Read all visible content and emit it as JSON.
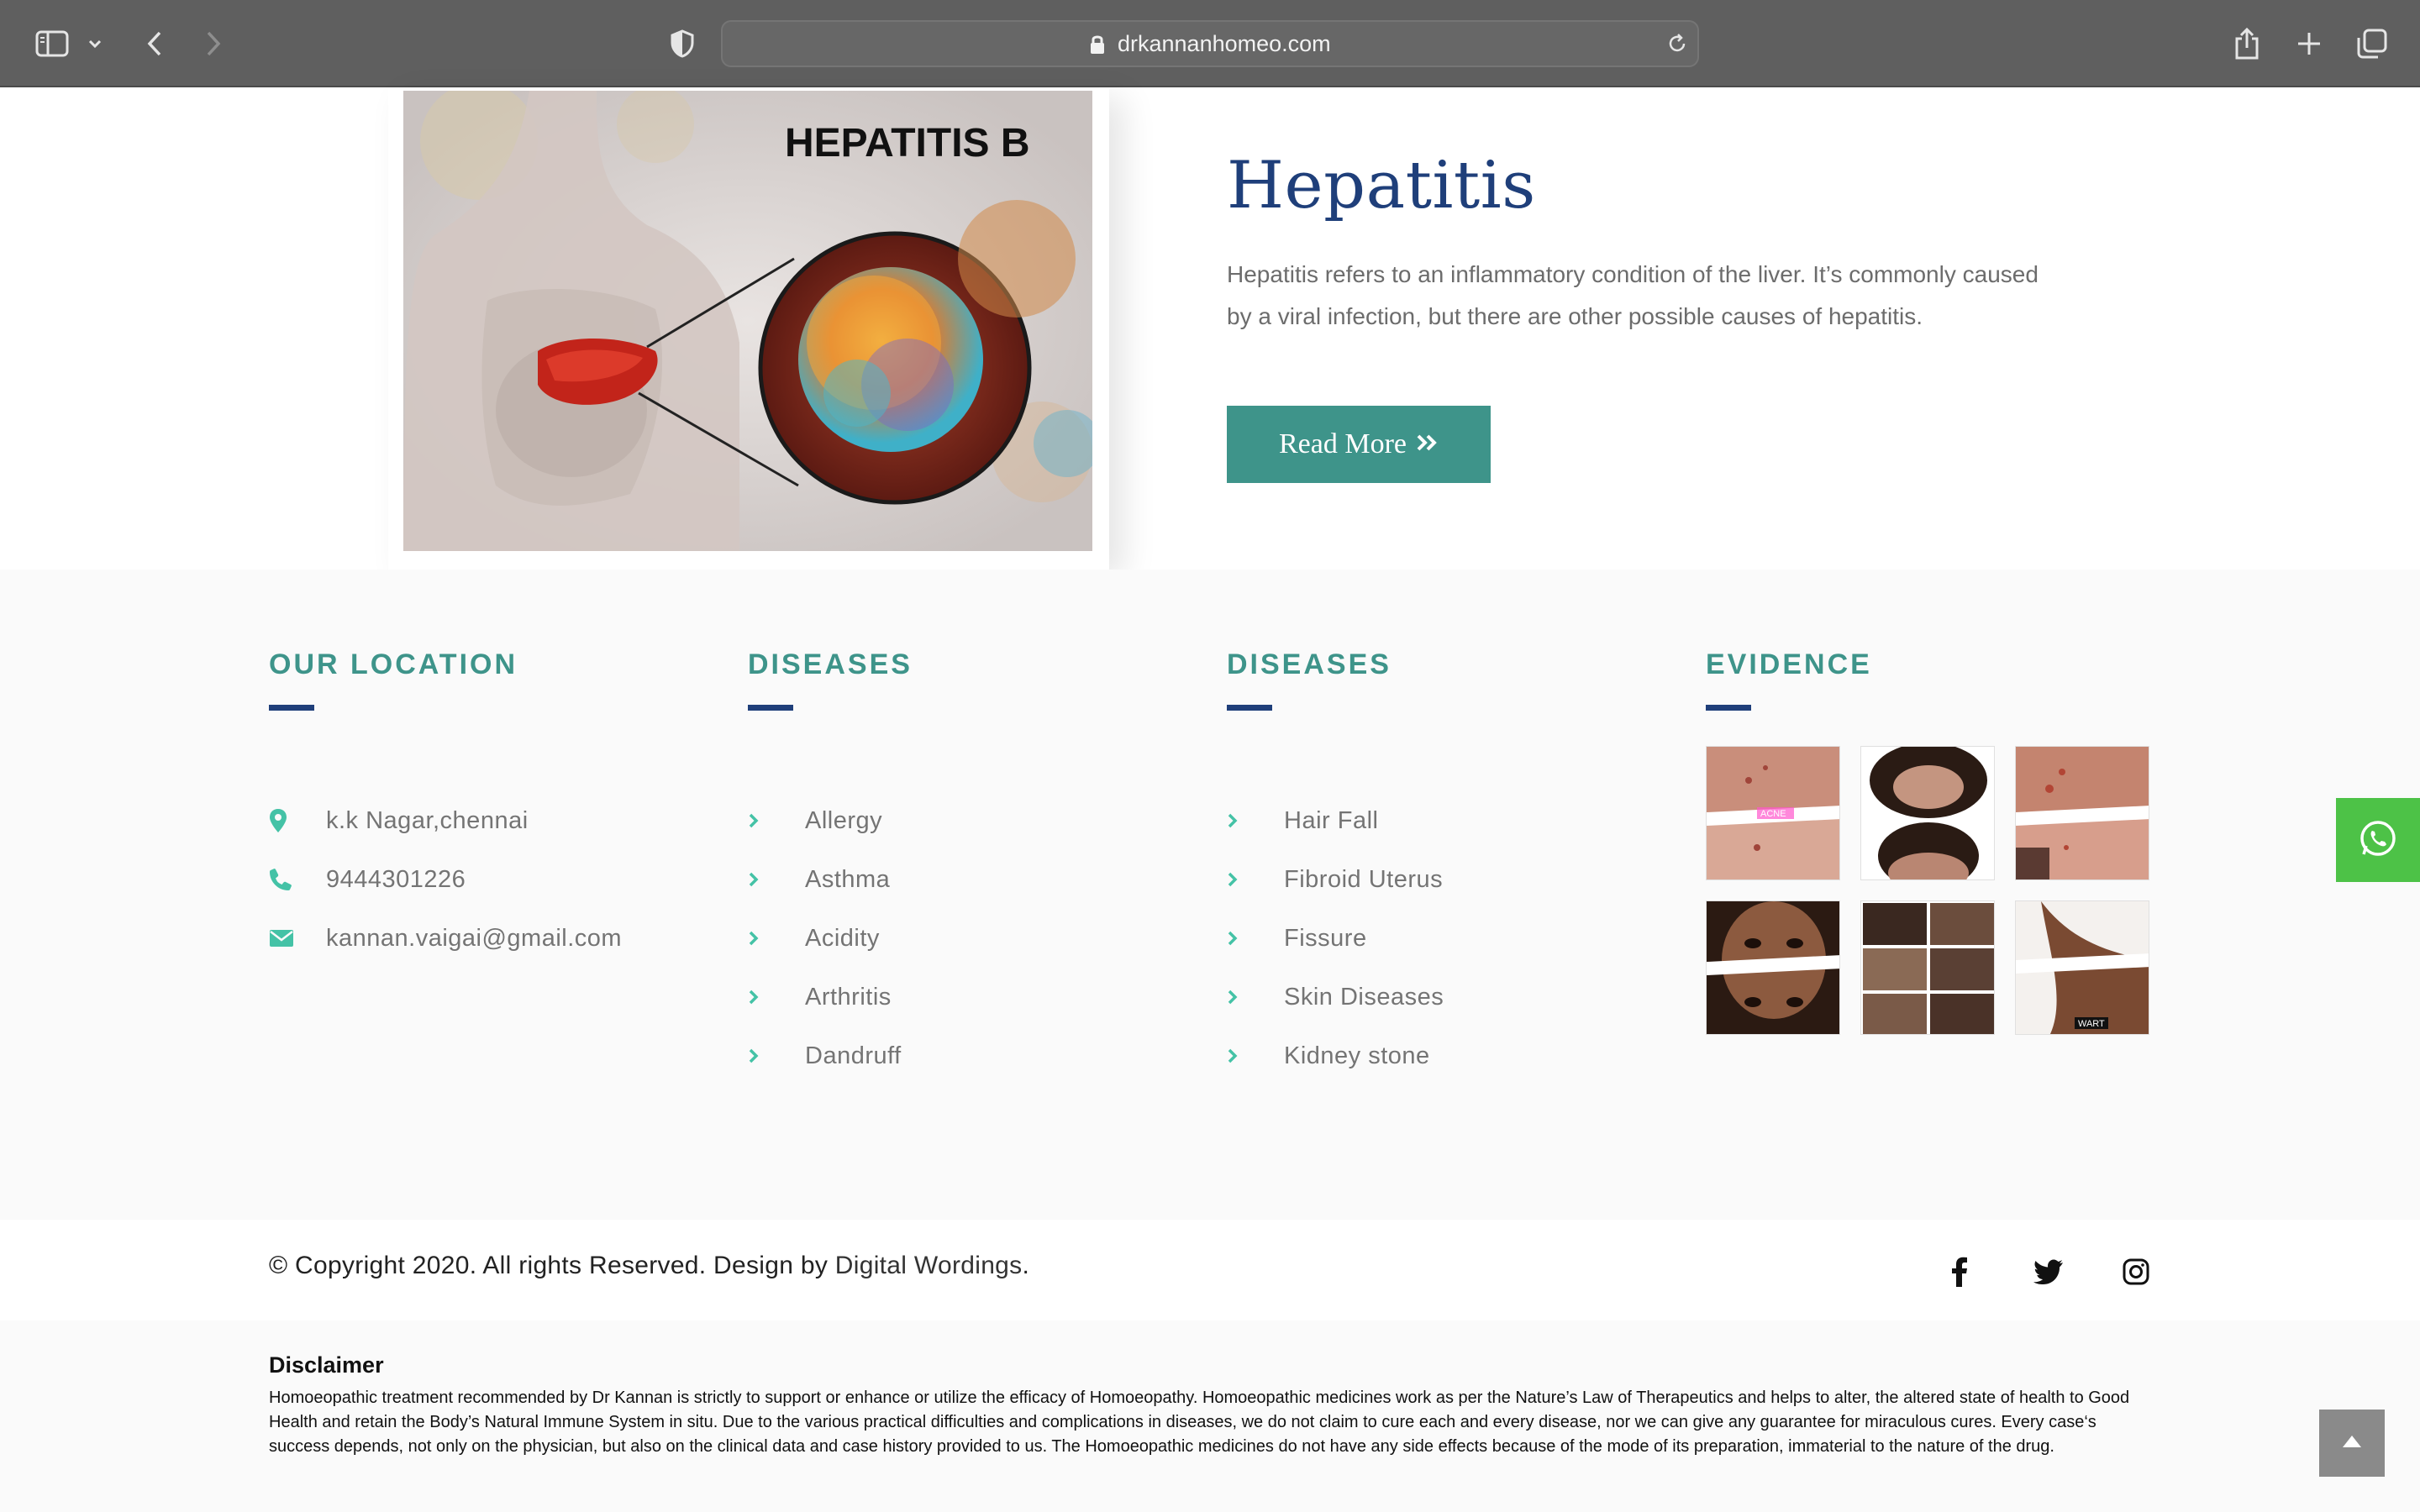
{
  "browser": {
    "url": "drkannanhomeo.com"
  },
  "hero": {
    "image_caption": "HEPATITIS B",
    "title": "Hepatitis",
    "description": "Hepatitis refers to an inflammatory condition of the liver. It’s commonly caused by a viral infection, but there are other possible causes of hepatitis.",
    "read_more_label": "Read More",
    "read_more_color": "#3e948a",
    "title_color": "#1f3f7a"
  },
  "footer": {
    "location": {
      "heading": "OUR LOCATION",
      "items": [
        {
          "icon": "map-pin-icon",
          "text": "k.k Nagar,chennai"
        },
        {
          "icon": "phone-icon",
          "text": "9444301226"
        },
        {
          "icon": "envelope-icon",
          "text": "kannan.vaigai@gmail.com"
        }
      ]
    },
    "diseases_1": {
      "heading": "DISEASES",
      "items": [
        "Allergy",
        "Asthma",
        "Acidity",
        "Arthritis",
        "Dandruff"
      ]
    },
    "diseases_2": {
      "heading": "DISEASES",
      "items": [
        "Hair Fall",
        "Fibroid Uterus",
        "Fissure",
        "Skin Diseases",
        "Kidney stone"
      ]
    },
    "evidence": {
      "heading": "EVIDENCE",
      "thumbnails": [
        "ACNE",
        "",
        "",
        "",
        "",
        "WART"
      ]
    },
    "accent_color": "#3e948a"
  },
  "copyright": {
    "text": "© Copyright 2020.  All rights Reserved. Design by ",
    "link": "Digital Wordings",
    "suffix": "."
  },
  "disclaimer": {
    "title": "Disclaimer",
    "body": "Homoeopathic treatment recommended by Dr Kannan is strictly to support or enhance or utilize the efficacy of Homoeopathy. Homoeopathic medicines work as per the Nature’s Law of Therapeutics and helps to alter, the altered state of health to Good Health and retain the Body’s Natural Immune System in situ. Due to the various practical difficulties and complications in diseases, we do not claim to cure each and every disease, nor we can give any guarantee for miraculous cures. Every case‘s success depends, not only on the physician, but also on the clinical data and case history provided to us. The Homoeopathic medicines do not have any side effects because of the mode of its preparation, immaterial to the nature of the drug."
  }
}
